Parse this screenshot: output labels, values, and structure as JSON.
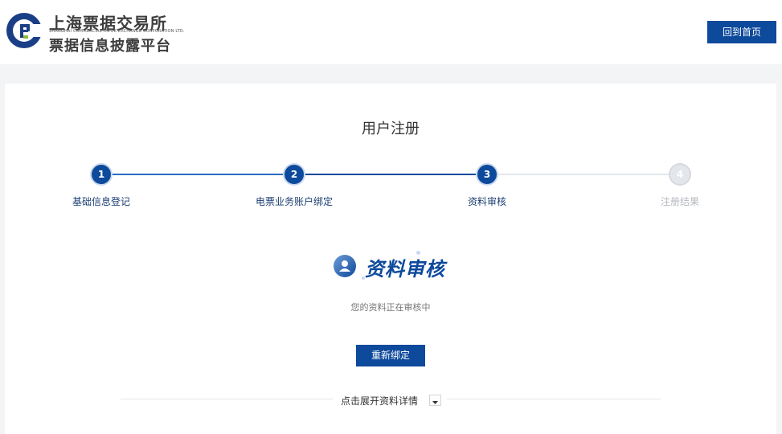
{
  "header": {
    "logo_title_cn": "上海票据交易所",
    "logo_title_en": "SHANGHAI COMMERCIAL PAPER EXCHANGE CORPORATION LTD.",
    "logo_subtitle": "票据信息披露平台",
    "home_button": "回到首页"
  },
  "registration": {
    "title": "用户注册",
    "steps": [
      {
        "number": "1",
        "label": "基础信息登记",
        "state": "done"
      },
      {
        "number": "2",
        "label": "电票业务账户绑定",
        "state": "done"
      },
      {
        "number": "3",
        "label": "资料审核",
        "state": "current"
      },
      {
        "number": "4",
        "label": "注册结果",
        "state": "pending"
      }
    ],
    "status_title": "资料审核",
    "status_desc": "您的资料正在审核中",
    "rebind_button": "重新绑定",
    "expand_label": "点击展开资料详情"
  },
  "colors": {
    "primary": "#0e4a9c",
    "pending": "#e3e6eb",
    "background": "#f3f4f6"
  }
}
